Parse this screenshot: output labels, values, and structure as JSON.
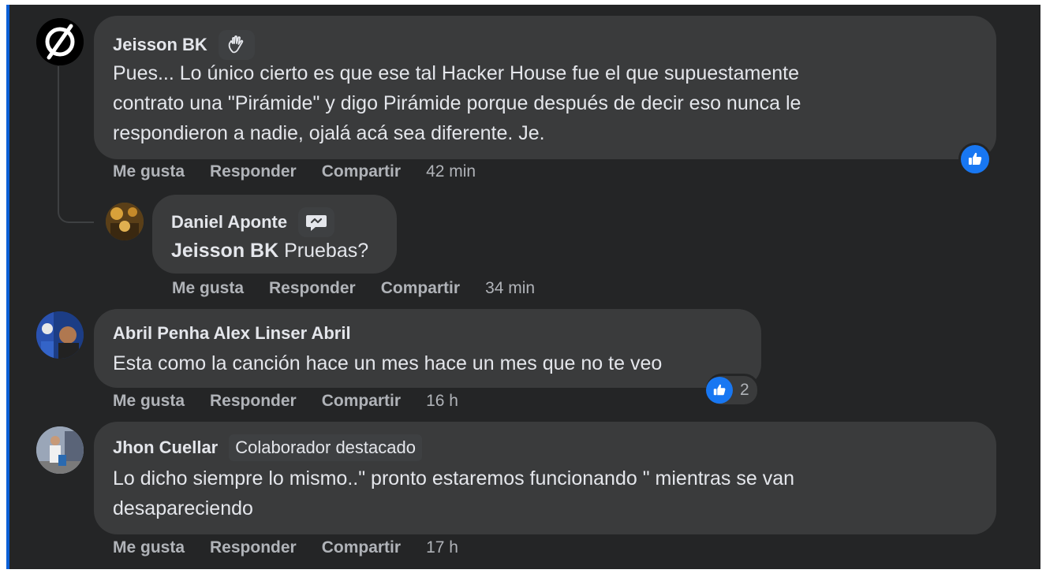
{
  "comments": [
    {
      "author": "Jeisson BK",
      "badge_icon": "waving-hand-icon",
      "lines": [
        "Pues... Lo único cierto es que ese tal Hacker House fue el que supuestamente",
        "contrato una \"Pirámide\" y digo Pirámide porque después de decir eso nunca le",
        "respondieron a nadie, ojalá acá sea diferente. Je."
      ],
      "time": "42 min",
      "reaction_icon": "like-icon"
    },
    {
      "author": "Daniel Aponte",
      "badge_icon": "chat-bubble-icon",
      "mention": "Jeisson BK",
      "text": "Pruebas?",
      "time": "34 min"
    },
    {
      "author": "Abril Penha Alex Linser Abril",
      "text": "Esta como la canción hace un mes hace un mes que no te veo",
      "time": "16 h",
      "reaction_icon": "like-icon",
      "reaction_count": "2"
    },
    {
      "author": "Jhon Cuellar",
      "badge": "Colaborador destacado",
      "lines": [
        "Lo dicho siempre lo mismo..\" pronto estaremos funcionando \" mientras se van",
        "desapareciendo"
      ],
      "time": "17 h"
    }
  ],
  "actions": {
    "like": "Me gusta",
    "reply": "Responder",
    "share": "Compartir"
  },
  "colors": {
    "background": "#242526",
    "bubble": "#3a3b3c",
    "text": "#e4e6eb",
    "secondary_text": "#b0b3b8",
    "like_blue": "#1877f2"
  }
}
